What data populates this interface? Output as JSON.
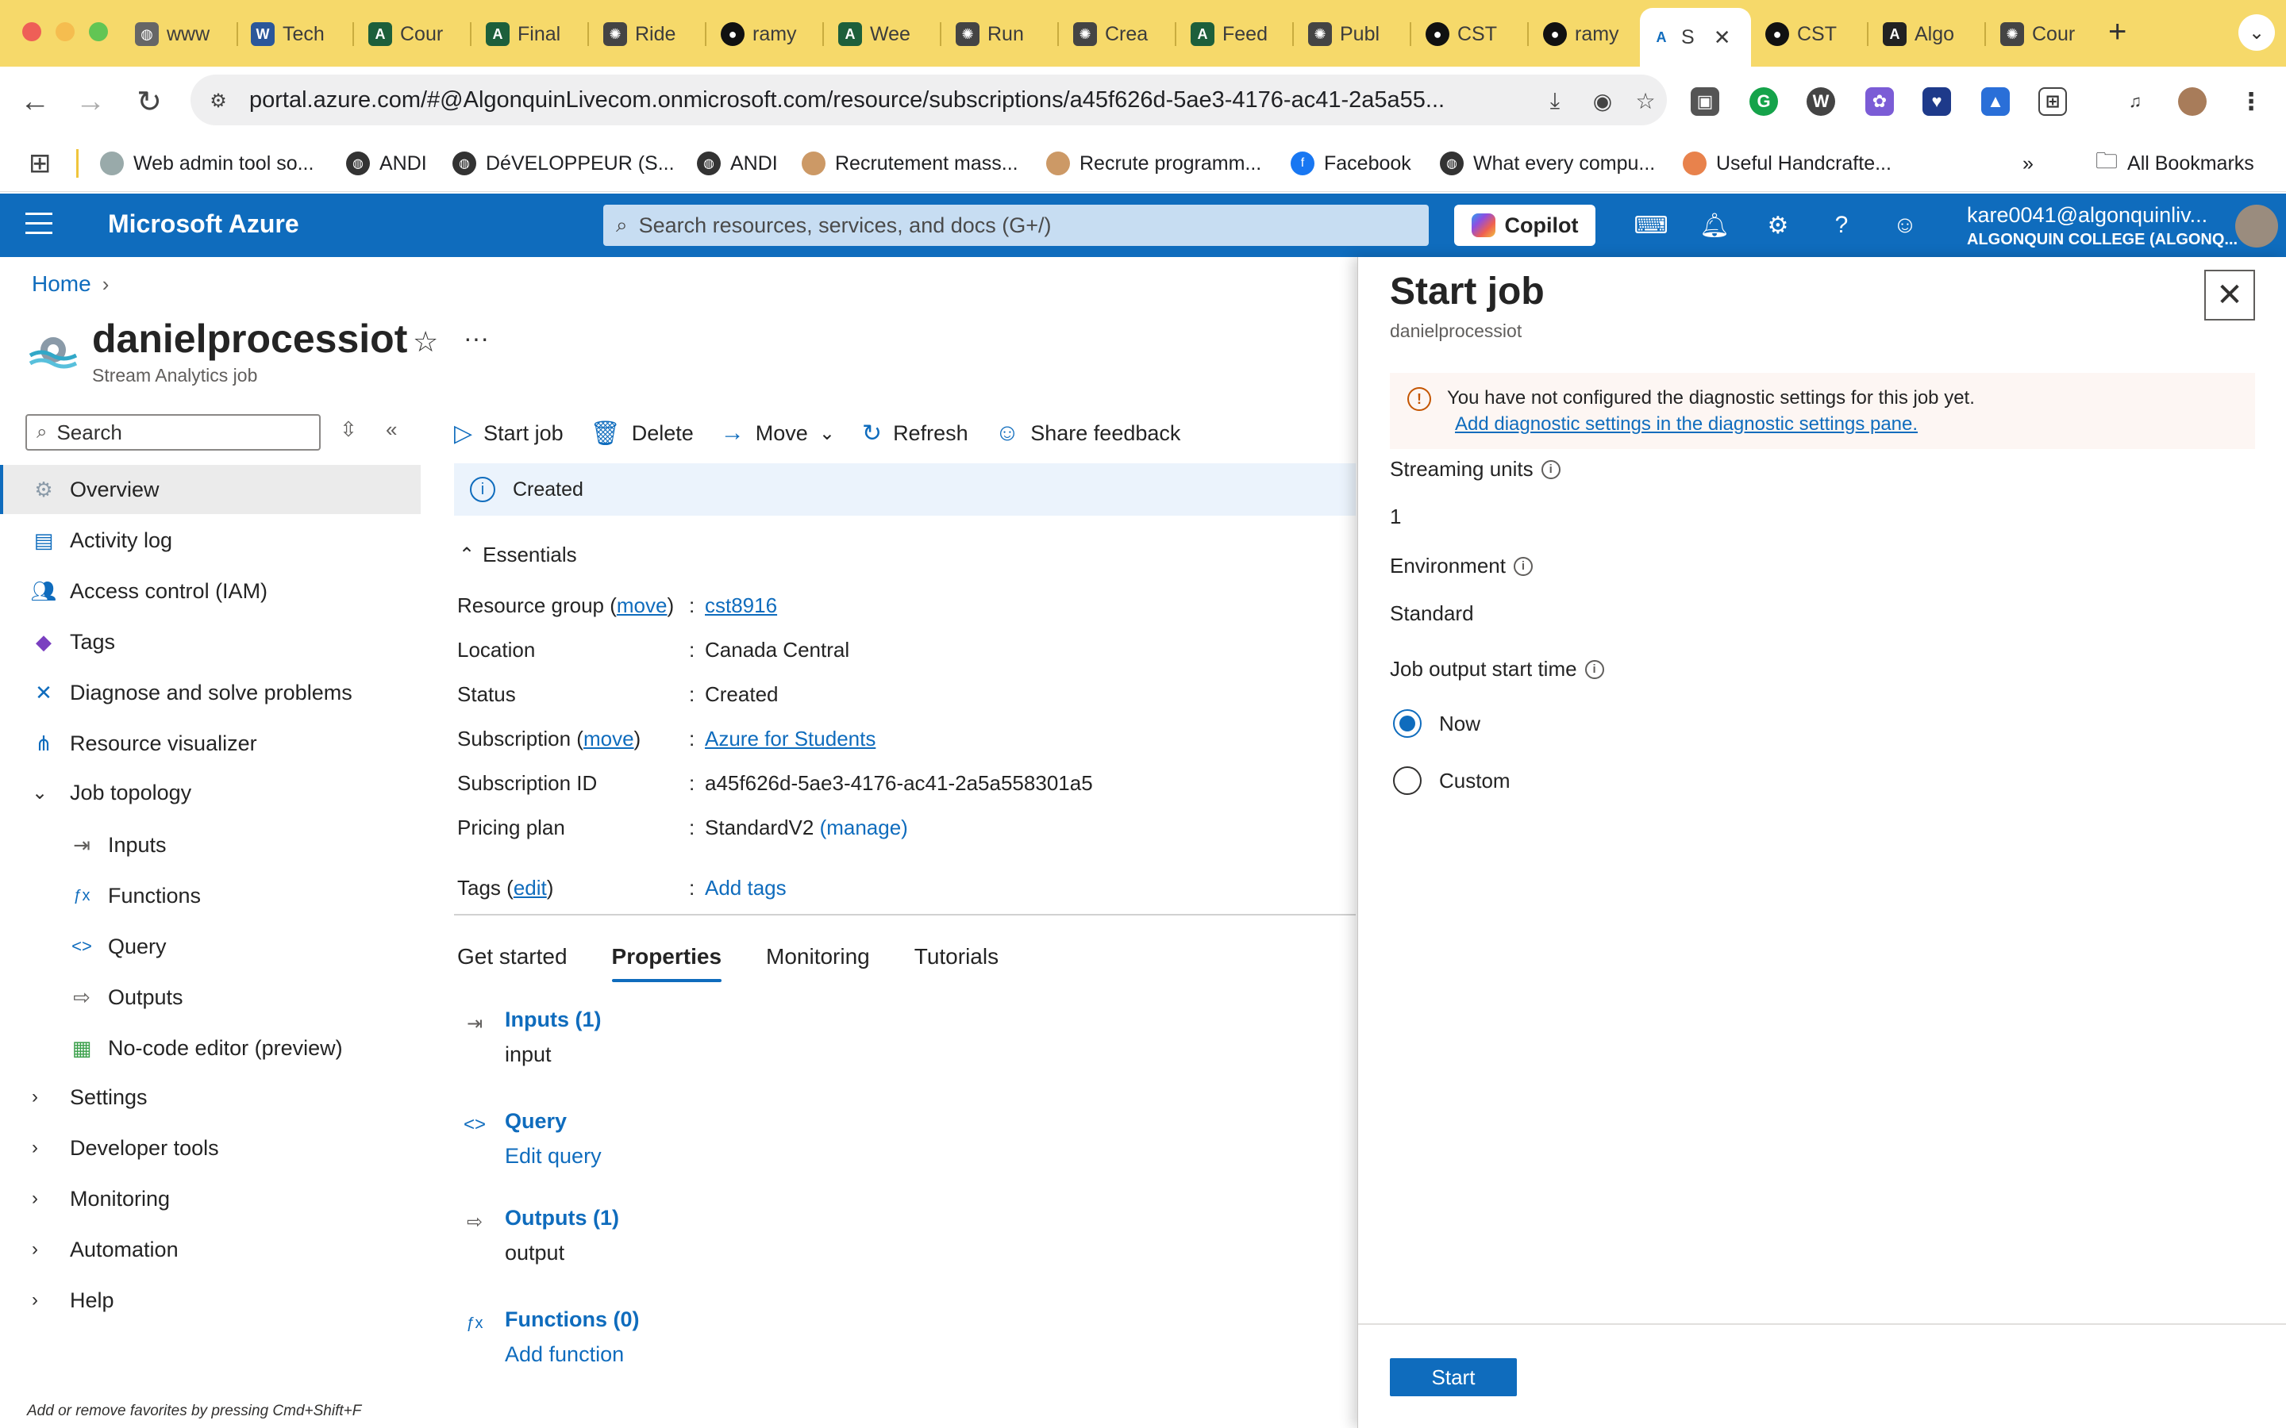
{
  "browser": {
    "tabs": [
      {
        "label": "www",
        "icon": "globe-icon"
      },
      {
        "label": "Tech",
        "icon": "word-icon"
      },
      {
        "label": "Cour",
        "icon": "algonquin-icon"
      },
      {
        "label": "Final",
        "icon": "algonquin-icon"
      },
      {
        "label": "Ride",
        "icon": "chatgpt-icon"
      },
      {
        "label": "ramy",
        "icon": "github-icon"
      },
      {
        "label": "Wee",
        "icon": "algonquin-icon"
      },
      {
        "label": "Run",
        "icon": "chatgpt-icon"
      },
      {
        "label": "Crea",
        "icon": "chatgpt-icon"
      },
      {
        "label": "Feed",
        "icon": "algonquin-icon"
      },
      {
        "label": "Publ",
        "icon": "chatgpt-icon"
      },
      {
        "label": "CST",
        "icon": "github-icon"
      },
      {
        "label": "ramy",
        "icon": "github-icon"
      },
      {
        "label": "S",
        "icon": "azure-icon"
      },
      {
        "label": "CST",
        "icon": "github-icon"
      },
      {
        "label": "Algo",
        "icon": "algonquin-icon"
      },
      {
        "label": "Cour",
        "icon": "chatgpt-icon"
      }
    ],
    "url": "portal.azure.com/#@AlgonquinLivecom.onmicrosoft.com/resource/subscriptions/a45f626d-5ae3-4176-ac41-2a5a55...",
    "bookmarks": [
      "Web admin tool so...",
      "ANDI",
      "DéVELOPPEUR (S...",
      "ANDI",
      "Recrutement mass...",
      "Recrute programm...",
      "Facebook",
      "What every compu...",
      "Useful Handcrafte..."
    ],
    "all_bookmarks": "All Bookmarks",
    "more_bookmarks": "»"
  },
  "azure": {
    "title": "Microsoft Azure",
    "search_placeholder": "Search resources, services, and docs (G+/)",
    "copilot": "Copilot",
    "user_email": "kare0041@algonquinliv...",
    "user_org": "ALGONQUIN COLLEGE (ALGONQ..."
  },
  "breadcrumb": {
    "home": "Home",
    "sep": "›"
  },
  "resource": {
    "name": "danielprocessiot",
    "type": "Stream Analytics job"
  },
  "nav": {
    "search_placeholder": "Search",
    "items": [
      {
        "label": "Overview",
        "icon": "overview-icon"
      },
      {
        "label": "Activity log",
        "icon": "activity-log-icon"
      },
      {
        "label": "Access control (IAM)",
        "icon": "iam-icon"
      },
      {
        "label": "Tags",
        "icon": "tag-icon"
      },
      {
        "label": "Diagnose and solve problems",
        "icon": "wrench-icon"
      },
      {
        "label": "Resource visualizer",
        "icon": "visualizer-icon"
      },
      {
        "label": "Job topology",
        "icon": "chevron-down-icon"
      },
      {
        "label": "Inputs",
        "icon": "input-icon"
      },
      {
        "label": "Functions",
        "icon": "function-icon"
      },
      {
        "label": "Query",
        "icon": "query-icon"
      },
      {
        "label": "Outputs",
        "icon": "output-icon"
      },
      {
        "label": "No-code editor (preview)",
        "icon": "no-code-icon"
      },
      {
        "label": "Settings",
        "icon": "chevron-right-icon"
      },
      {
        "label": "Developer tools",
        "icon": "chevron-right-icon"
      },
      {
        "label": "Monitoring",
        "icon": "chevron-right-icon"
      },
      {
        "label": "Automation",
        "icon": "chevron-right-icon"
      },
      {
        "label": "Help",
        "icon": "chevron-right-icon"
      }
    ],
    "fav_hint": "Add or remove favorites by pressing Cmd+Shift+F"
  },
  "commands": {
    "start": "Start job",
    "delete": "Delete",
    "move": "Move",
    "refresh": "Refresh",
    "feedback": "Share feedback"
  },
  "status": "Created",
  "essentials": {
    "header": "Essentials",
    "resource_group_label": "Resource group",
    "move1": "move",
    "resource_group": "cst8916",
    "location_label": "Location",
    "location": "Canada Central",
    "status_label": "Status",
    "status": "Created",
    "subscription_label": "Subscription",
    "move2": "move",
    "subscription": "Azure for Students",
    "subscription_id_label": "Subscription ID",
    "subscription_id": "a45f626d-5ae3-4176-ac41-2a5a558301a5",
    "pricing_label": "Pricing plan",
    "pricing": "StandardV2",
    "manage": "(manage)",
    "tags_label": "Tags",
    "edit": "edit",
    "add_tags": "Add tags"
  },
  "main_tabs": [
    "Get started",
    "Properties",
    "Monitoring",
    "Tutorials"
  ],
  "properties": [
    {
      "title": "Inputs (1)",
      "sub": "input"
    },
    {
      "title": "Query",
      "sub": "Edit query"
    },
    {
      "title": "Outputs (1)",
      "sub": "output"
    },
    {
      "title": "Functions (0)",
      "sub": "Add function"
    }
  ],
  "panel": {
    "title": "Start job",
    "subtitle": "danielprocessiot",
    "warning": "You have not configured the diagnostic settings for this job yet.",
    "warning_link": "Add diagnostic settings in the diagnostic settings pane.",
    "streaming_units_label": "Streaming units",
    "streaming_units": "1",
    "environment_label": "Environment",
    "environment": "Standard",
    "output_start_label": "Job output start time",
    "option_now": "Now",
    "option_custom": "Custom",
    "selected": "Now",
    "start_button": "Start"
  },
  "colors": {
    "tabbar": "#f6d96a",
    "azure_blue": "#0f6cbd"
  }
}
